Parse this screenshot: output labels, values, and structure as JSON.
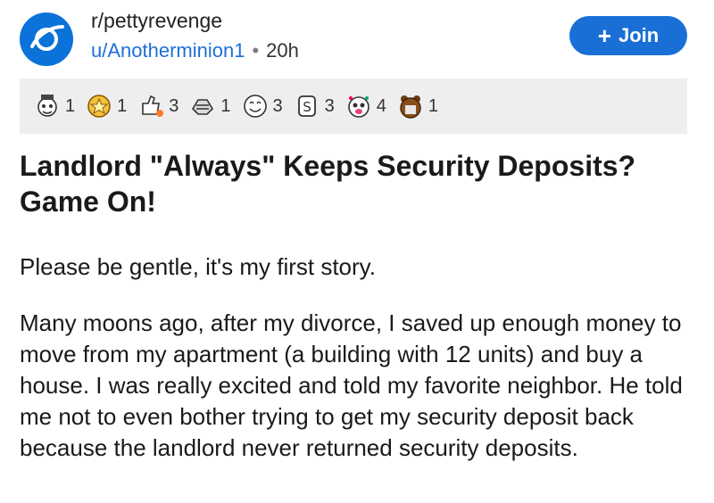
{
  "header": {
    "subreddit": "r/pettyrevenge",
    "username": "u/Anotherminion1",
    "separator": "•",
    "time": "20h",
    "join_label": "Join",
    "join_icon": "plus-icon"
  },
  "awards": [
    {
      "icon": "award-1-icon",
      "count": "1"
    },
    {
      "icon": "award-2-icon",
      "count": "1"
    },
    {
      "icon": "award-3-icon",
      "count": "3"
    },
    {
      "icon": "award-4-icon",
      "count": "1"
    },
    {
      "icon": "award-5-icon",
      "count": "3"
    },
    {
      "icon": "award-6-icon",
      "count": "3"
    },
    {
      "icon": "award-7-icon",
      "count": "4"
    },
    {
      "icon": "award-8-icon",
      "count": "1"
    }
  ],
  "post": {
    "title": "Landlord \"Always\" Keeps Security Deposits? Game On!",
    "paragraphs": [
      "Please be gentle, it's my first story.",
      "Many moons ago, after my divorce, I saved up enough money to move from my apartment (a building with 12 units) and buy a house.  I was really excited and told my favorite neighbor.  He told me not to even bother trying to get my security deposit back because the landlord never returned security deposits."
    ]
  },
  "colors": {
    "accent": "#1a6fd6",
    "avatar_bg": "#0a72d8",
    "award_bar": "#eeeeee"
  }
}
